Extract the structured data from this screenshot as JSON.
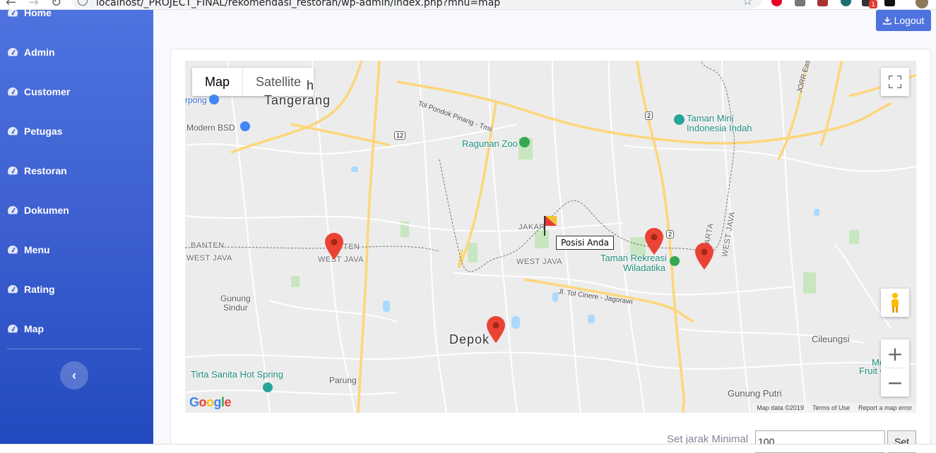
{
  "browser": {
    "url": "localhost/_PROJECT_FINAL/rekomendasi_restoran/wp-admin/index.php?mnu=map",
    "extension_badge": "1"
  },
  "sidebar": {
    "items": [
      {
        "label": "Home"
      },
      {
        "label": "Admin"
      },
      {
        "label": "Customer"
      },
      {
        "label": "Petugas"
      },
      {
        "label": "Restoran"
      },
      {
        "label": "Dokumen"
      },
      {
        "label": "Menu"
      },
      {
        "label": "Rating"
      },
      {
        "label": "Map"
      }
    ],
    "toggle_glyph": "‹"
  },
  "topbar": {
    "logout_label": "Logout"
  },
  "map": {
    "type_map": "Map",
    "type_satellite": "Satellite",
    "tooltip": "Posisi Anda",
    "labels": {
      "tangerang_h": "h",
      "tangerang": "Tangerang",
      "rpong": "rpong",
      "modern_bsd": "Modern BSD",
      "tol_pondok": "Tol Pondok Pinang - Tmii",
      "ragunan": "Ragunan Zoo",
      "taman_mini": "Taman Mini",
      "indonesia_indah": "Indonesia Indah",
      "jorr": "JORR East",
      "jakarta_short": "JAKAR",
      "banten_left": "BANTEN",
      "west_java_left": "WEST JAVA",
      "banten_mid": "TEN",
      "west_java_mid": "WEST JAVA",
      "west_java_center": "WEST JAVA",
      "west_java_right": "WEST JAVA",
      "jakarta_right": "KARTA",
      "taman_rekreasi": "Taman Rekreasi",
      "wiladatika": "Wiladatika",
      "tol_cinere": "Jl. Tol Cinere - Jagorawi",
      "gunung_sindur_1": "Gunung",
      "gunung_sindur_2": "Sindur",
      "depok": "Depok",
      "cileungsi": "Cileungsi",
      "mekarsari_1": "Mekarsa",
      "mekarsari_2": "Fruit Garde",
      "tirta": "Tirta Sanita Hot Spring",
      "parung": "Parung",
      "gunung_putri": "Gunung Putri",
      "road_12": "12",
      "road_2a": "2",
      "road_2b": "2"
    },
    "attribution": {
      "data": "Map data ©2019",
      "terms": "Terms of Use",
      "report": "Report a map error"
    },
    "google_logo": "Google",
    "zoom_in": "+",
    "zoom_out": "−",
    "colors": {
      "pin": "#ea4335",
      "road_major": "#fdd67a",
      "water": "#aadaff",
      "park": "#c8e6c0"
    }
  },
  "controls": {
    "set_label": "Set jarak Minimal",
    "set_value": "100",
    "set_button": "Set"
  }
}
